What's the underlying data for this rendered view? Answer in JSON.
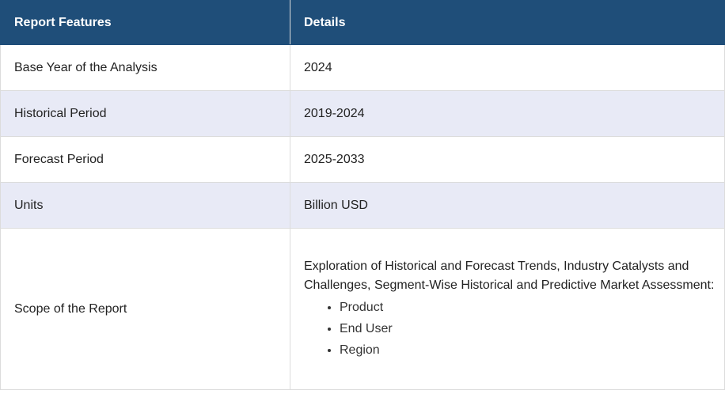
{
  "table": {
    "headers": [
      "Report Features",
      "Details"
    ],
    "rows": [
      {
        "feature": "Base Year of the Analysis",
        "detail": "2024"
      },
      {
        "feature": "Historical Period",
        "detail": "2019-2024"
      },
      {
        "feature": "Forecast Period",
        "detail": "2025-2033"
      },
      {
        "feature": "Units",
        "detail": "Billion USD"
      }
    ],
    "scope": {
      "feature": "Scope of the Report",
      "detail": "Exploration of Historical and Forecast Trends, Industry Catalysts and Challenges, Segment-Wise Historical and Predictive Market Assessment:",
      "items": [
        "Product",
        "End User",
        "Region"
      ]
    }
  },
  "colors": {
    "header_bg": "#1f4e79",
    "alt_row_bg": "#e8eaf6"
  }
}
